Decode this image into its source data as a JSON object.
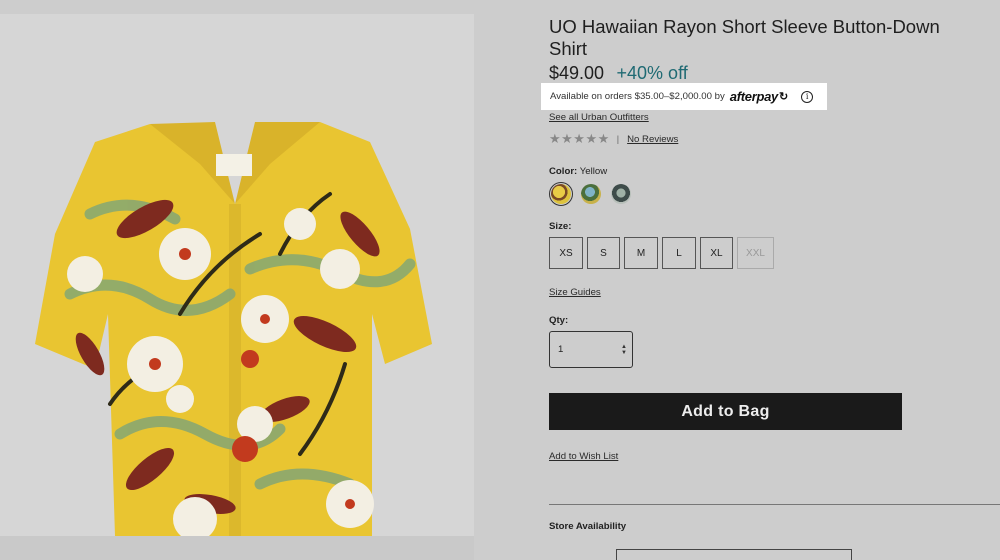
{
  "product": {
    "title": "UO Hawaiian Rayon Short Sleeve Button-Down Shirt",
    "price": "$49.00",
    "discount": "+40% off"
  },
  "afterpay": {
    "text": "Available on orders $35.00–$2,000.00 by",
    "logo": "afterpay",
    "badge": "↻",
    "info_icon": "info-icon",
    "info_glyph": "i"
  },
  "links": {
    "see_all": "See all Urban Outfitters",
    "reviews": "No Reviews",
    "size_guides": "Size Guides",
    "wish_list": "Add to Wish List"
  },
  "rating": {
    "stars": "★★★★★",
    "separator": "|"
  },
  "color": {
    "label": "Color:",
    "selected": "Yellow",
    "swatches": [
      "yellow",
      "blue",
      "grey"
    ]
  },
  "size": {
    "label": "Size:",
    "options": [
      {
        "label": "XS",
        "available": true
      },
      {
        "label": "S",
        "available": true
      },
      {
        "label": "M",
        "available": true
      },
      {
        "label": "L",
        "available": true
      },
      {
        "label": "XL",
        "available": true
      },
      {
        "label": "XXL",
        "available": false
      }
    ]
  },
  "qty": {
    "label": "Qty:",
    "value": "1",
    "arrow_up": "▲",
    "arrow_down": "▼"
  },
  "actions": {
    "add_to_bag": "Add to Bag"
  },
  "store": {
    "heading": "Store Availability"
  },
  "colors": {
    "accent_teal": "#1f6a73",
    "button_bg": "#1a1a1a",
    "shirt_yellow": "#e9c531"
  }
}
